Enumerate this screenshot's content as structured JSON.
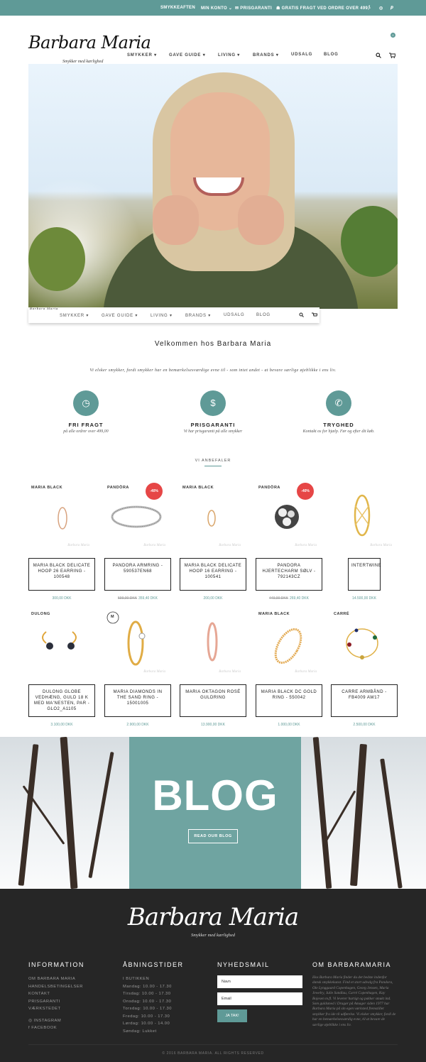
{
  "topbar": {
    "smykkeaften": "SMYKKEAFTEN",
    "account": "MIN KONTO ⌄",
    "prisgaranti": "✉ PRISGARANTI",
    "fragt": "☗ GRATIS FRAGT VED ORDRE OVER 499,-",
    "social": [
      "f",
      "◎",
      "𝒑"
    ]
  },
  "header": {
    "logo": "Barbara Maria",
    "slogan": "Smykker med kærlighed",
    "nav": [
      "SMYKKER ▾",
      "GAVE GUIDE ▾",
      "LIVING ▾",
      "BRANDS ▾",
      "UDSALG",
      "BLOG"
    ],
    "cart_count": "0"
  },
  "sticky": {
    "nav": [
      "SMYKKER ▾",
      "GAVE GUIDE ▾",
      "LIVING ▾",
      "BRANDS ▾",
      "UDSALG",
      "BLOG"
    ]
  },
  "welcome": {
    "title": "Velkommen hos Barbara Maria",
    "intro": "Vi elsker smykker, fordi smykker har en bemærkelsesværdige evne til - som intet andet - at bevare særlige øjeblikke i ens liv."
  },
  "features": [
    {
      "title": "FRI FRAGT",
      "desc": "på alle ordrer over 499,00",
      "icon": "clock-icon"
    },
    {
      "title": "PRISGARANTI",
      "desc": "Vi har prisgaranti på alle smykker",
      "icon": "dollar-icon"
    },
    {
      "title": "TRYGHED",
      "desc": "Kontakt os for hjælp. Før og efter dit køb.",
      "icon": "whatsapp-icon"
    }
  ],
  "section_label": "VI ANBEFALER",
  "products_row1": [
    {
      "brand": "MARIA BLACK",
      "name": "MARIA BLACK DELICATE HOOP 26 EARRING - 100548",
      "price": "300,00 DKK",
      "old": "",
      "sale": ""
    },
    {
      "brand": "PANDÖRA",
      "name": "PANDORA ARMRING - 590537EN68",
      "price": "359,40 DKK",
      "old": "599,00 DKK",
      "sale": "-40%"
    },
    {
      "brand": "MARIA BLACK",
      "name": "MARIA BLACK DELICATE HOOP 16 EARRING - 100541",
      "price": "200,00 DKK",
      "old": "",
      "sale": ""
    },
    {
      "brand": "PANDÖRA",
      "name": "PANDORA HJERTECHARM SØLV - 792143CZ",
      "price": "269,40 DKK",
      "old": "449,00 DKK",
      "sale": "-40%"
    },
    {
      "brand": "",
      "name": "INTERTWINE",
      "price": "14.500,00 DKK",
      "old": "",
      "sale": ""
    }
  ],
  "products_row2": [
    {
      "brand": "DULONG",
      "name": "DULONG GLOBE VEDHÆNG, GULD 18 K MED MA'NESTEN, PAR - GLO2_A1105",
      "price": "3.100,00 DKK"
    },
    {
      "brand": "M",
      "name": "MARIA DIAMONDS IN THE SAND RING - 15001005",
      "price": "2.900,00 DKK"
    },
    {
      "brand": "",
      "name": "MARIA OKTAGON ROSÉ GULDRING",
      "price": "13.900,00 DKK"
    },
    {
      "brand": "MARIA BLACK",
      "name": "MARIA BLACK DC GOLD RING - 550042",
      "price": "1.000,00 DKK"
    },
    {
      "brand": "CARRÉ",
      "name": "CARRE ARMBÅND - FB4009 AW17",
      "price": "2.500,00 DKK"
    }
  ],
  "watermark": "Barbara Maria",
  "blog": {
    "word": "BLOG",
    "button": "READ OUR BLOG"
  },
  "footer": {
    "logo": "Barbara Maria",
    "slogan": "Smykker med kærlighed",
    "info_title": "INFORMATION",
    "info_links": [
      "OM BARBARA MARIA",
      "HANDELSBETINGELSER",
      "KONTAKT",
      "PRISGARANTI",
      "VÆRKSTEDET"
    ],
    "social": [
      "INSTAGRAM",
      "FACEBOOK"
    ],
    "hours_title": "ÅBNINGSTIDER",
    "hours": [
      "I BUTIKKEN",
      "Mandag: 10.00 - 17.30",
      "Tirsdag: 10.00 - 17.30",
      "Onsdag: 10.00 - 17.30",
      "Torsdag: 10.00 - 17.30",
      "Fredag: 10.00 - 17.30",
      "Lørdag: 10.00 - 14.00",
      "Søndag: Lukket"
    ],
    "newsletter_title": "NYHEDSMAIL",
    "name_placeholder": "Navn",
    "email_placeholder": "Email",
    "submit": "JA TAK!",
    "about_title": "OM BARBARAMARIA",
    "about_text": "Hos Barbara Maria finder du det bedste indenfor dansk smykkekunst. Find et stort udvalg fra Pandora, Ole Lynggaard Copenhagen, Georg Jensen, Maria Jewelry, Julie Sandlau, Carré Copenhagen, Kay Bojesen m.fl. Vi leverer hurtigt og pakker smukt ind. Som guldsmed i Dragør på Amager siden 1977 har Barbara Maria på sin egen værksted fremstillet smykker fra ide til udførelse. Vi elsker smykker, fordi de har en bemærkelsesværdig evne, til at bevare de særlige øjeblikke i ens liv.",
    "copyright": "© 2016 BARBARA MARIA. ALL RIGHTS RESERVED"
  },
  "colors": {
    "accent": "#5f9a97",
    "sale": "#e64646",
    "footer_bg": "#262626"
  }
}
